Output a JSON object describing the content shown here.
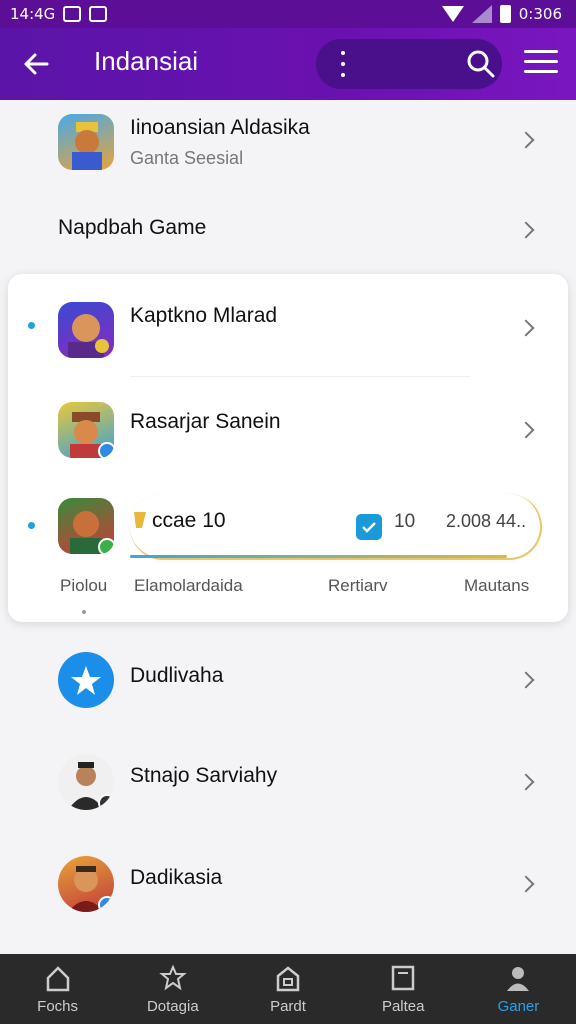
{
  "status_bar": {
    "left_text": "14:4G",
    "time": "0:306"
  },
  "app_bar": {
    "title": "Indansiai"
  },
  "rows": [
    {
      "title": "Iinoansian Aldasika",
      "subtitle": "Ganta Seesial"
    },
    {
      "title": "Napdbah Game"
    }
  ],
  "card": {
    "items": [
      {
        "title": "Kaptkno Mlarad"
      },
      {
        "title": "Rasarjar Sanein"
      }
    ],
    "progress_row": {
      "title": "ccae 10",
      "check_count": "10",
      "amount": "2.008 44..",
      "progress": 0.92
    },
    "tabs": [
      {
        "label": "Piolou",
        "active": true
      },
      {
        "label": "Elamolardaida",
        "active": false
      },
      {
        "label": "Rertiarv",
        "active": false
      },
      {
        "label": "Mautans",
        "active": false
      }
    ]
  },
  "list": [
    {
      "title": "Dudlivaha"
    },
    {
      "title": "Stnajo Sarviahy"
    },
    {
      "title": "Dadikasia"
    }
  ],
  "bottom_nav": [
    {
      "label": "Fochs",
      "icon": "home-icon",
      "active": false
    },
    {
      "label": "Dotagia",
      "icon": "star-badge-icon",
      "active": false
    },
    {
      "label": "Pardt",
      "icon": "store-icon",
      "active": false
    },
    {
      "label": "Paltea",
      "icon": "book-icon",
      "active": false
    },
    {
      "label": "Ganer",
      "icon": "profile-icon",
      "active": true
    }
  ],
  "colors": {
    "app_bar": "#6a11b0",
    "accent": "#1a9ad8",
    "nav_bg": "#2a2a2a"
  }
}
